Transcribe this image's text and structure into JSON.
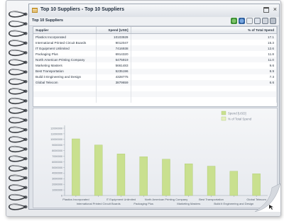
{
  "window": {
    "title": "Top 10 Suppliers - Top 10 Suppliers",
    "close_glyph": "×"
  },
  "panel": {
    "title": "Top 10 Suppliers"
  },
  "toolbar": {
    "icons": [
      "refresh-icon",
      "globe-icon",
      "copy-icon",
      "export-icon",
      "print-icon",
      "menu-icon"
    ]
  },
  "table": {
    "headers": [
      "Supplier",
      "Spend [USD]",
      "% of Total Spend"
    ],
    "rows": [
      [
        "Plastics Incorporated",
        "10103929",
        "17.1"
      ],
      [
        "International Printed Circuit Boards",
        "9012047",
        "15.3"
      ],
      [
        "IT Equipment Unlimited",
        "7416938",
        "12.6"
      ],
      [
        "Packaging Plus",
        "6914320",
        "11.8"
      ],
      [
        "North American Printing Company",
        "6475919",
        "11.0"
      ],
      [
        "Marketing Masters",
        "5661483",
        "9.6"
      ],
      [
        "Best Transportation",
        "5235196",
        "8.9"
      ],
      [
        "Build it Engineering and Design",
        "4328775",
        "7.3"
      ],
      [
        "Global Telecom",
        "3879659",
        "6.6"
      ]
    ]
  },
  "colors": {
    "bar": "#c9e08f",
    "bar_edge": "#a9c86a",
    "line_marker": "#e6efbf"
  },
  "chart_data": {
    "type": "bar",
    "categories": [
      "Plastics Incorporated",
      "International Printed Circuit Boards",
      "IT Equipment Unlimited",
      "Packaging Plus",
      "North American Printing Company",
      "Marketing Masters",
      "Best Transportation",
      "Build it Engineering and Design",
      "Global Telecom"
    ],
    "series": [
      {
        "name": "Spend [USD]",
        "values": [
          10103929,
          9012047,
          7416938,
          6914320,
          6475919,
          5661483,
          5235196,
          4328775,
          3879659
        ]
      },
      {
        "name": "% of Total Spend",
        "values": [
          17.1,
          15.3,
          12.6,
          11.8,
          11.0,
          9.6,
          8.9,
          7.3,
          6.6
        ]
      }
    ],
    "ylim": [
      0,
      12000000
    ],
    "yticks": [
      "12000000",
      "11000000",
      "10000000",
      "9000000",
      "8000000",
      "7000000",
      "6000000",
      "5000000",
      "4000000",
      "3000000",
      "2000000",
      "1000000",
      "0"
    ],
    "legend": "top-right",
    "grid": false
  }
}
